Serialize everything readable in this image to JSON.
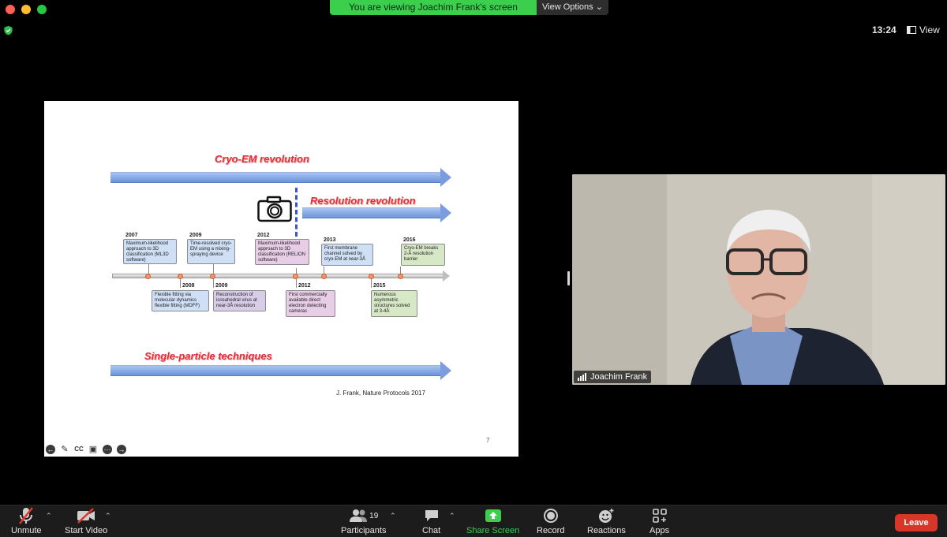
{
  "window": {
    "title": ""
  },
  "banner": {
    "text": "You are viewing Joachim Frank's screen",
    "view_options": "View Options"
  },
  "status": {
    "time": "13:24",
    "view_label": "View"
  },
  "slide": {
    "title_top": "Cryo-EM revolution",
    "title_resolution": "Resolution revolution",
    "title_single": "Single-particle techniques",
    "citation": "J. Frank, Nature Protocols 2017",
    "page_number": "7",
    "events": [
      {
        "year": "2007",
        "text": "Maximum-likelihood approach to 3D classification (ML3D software)"
      },
      {
        "year": "2009",
        "text": "Time-resolved cryo-EM using a mixing-spraying device"
      },
      {
        "year": "2012",
        "text": "Maximum-likelihood approach to 3D classification (RELION software)"
      },
      {
        "year": "2013",
        "text": "First membrane channel solved by cryo-EM at near-3Å"
      },
      {
        "year": "2016",
        "text": "Cryo-EM breaks 2-Å resolution barrier"
      },
      {
        "year": "2008",
        "text": "Flexible fitting via molecular dynamics flexible fitting (MDFF)"
      },
      {
        "year": "2009",
        "text": "Reconstruction of icosahedral virus at near-3Å resolution"
      },
      {
        "year": "2012",
        "text": "First commercially available direct electron detecting cameras"
      },
      {
        "year": "2015",
        "text": "Numerous asymmetric structures solved at 3-4Å"
      }
    ]
  },
  "video": {
    "participant_name": "Joachim Frank"
  },
  "toolbar": {
    "unmute": "Unmute",
    "start_video": "Start Video",
    "participants": "Participants",
    "participants_count": "19",
    "chat": "Chat",
    "share_screen": "Share Screen",
    "record": "Record",
    "reactions": "Reactions",
    "apps": "Apps",
    "leave": "Leave"
  },
  "colors": {
    "banner_green": "#3ccf4e",
    "leave_red": "#d9362a",
    "accent_red_text": "#e0303a"
  }
}
